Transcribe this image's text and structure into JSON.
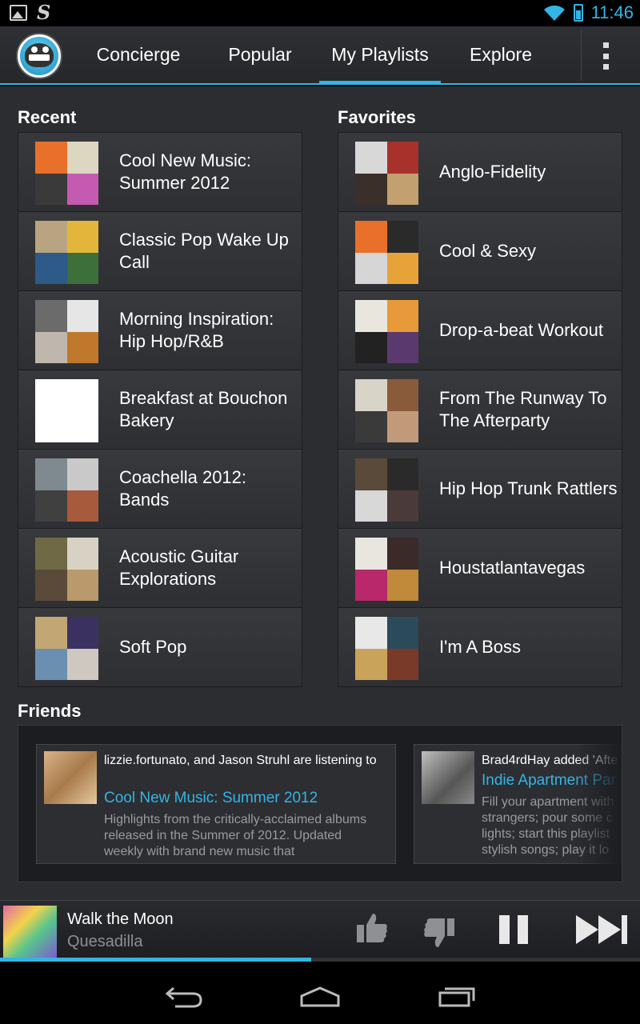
{
  "status_bar": {
    "time": "11:46"
  },
  "tabs": [
    "Concierge",
    "Popular",
    "My Playlists",
    "Explore"
  ],
  "active_tab": "My Playlists",
  "sections": {
    "recent": "Recent",
    "favorites": "Favorites",
    "friends": "Friends"
  },
  "recent": [
    {
      "title": "Cool New Music: Summer 2012",
      "colors": [
        "#e8702a",
        "#ddd6c0",
        "#3a3a3a",
        "#c45bb0"
      ]
    },
    {
      "title": "Classic Pop Wake Up Call",
      "colors": [
        "#b8a480",
        "#e3b63b",
        "#2d5a88",
        "#3d6f3a"
      ]
    },
    {
      "title": "Morning Inspiration: Hip Hop/R&B",
      "colors": [
        "#6b6b6b",
        "#e6e6e6",
        "#bfb7ad",
        "#c0782d"
      ]
    },
    {
      "title": "Breakfast at Bouchon Bakery",
      "colors": [
        "#ffffff",
        "#ffffff",
        "#ffffff",
        "#ffffff"
      ]
    },
    {
      "title": "Coachella 2012: Bands",
      "colors": [
        "#7e8a8f",
        "#c9c9c9",
        "#404040",
        "#a85a3c"
      ]
    },
    {
      "title": "Acoustic Guitar Explorations",
      "colors": [
        "#6f6a45",
        "#d8d2c4",
        "#5b4a3a",
        "#b89a6c"
      ]
    },
    {
      "title": "Soft Pop",
      "colors": [
        "#c2a774",
        "#3b3160",
        "#6b8fb0",
        "#cfc8c0"
      ]
    }
  ],
  "favorites": [
    {
      "title": "Anglo-Fidelity",
      "colors": [
        "#d8d8d8",
        "#a8322b",
        "#3b2f2a",
        "#c2a070"
      ]
    },
    {
      "title": "Cool & Sexy",
      "colors": [
        "#e8702a",
        "#2a2a2a",
        "#d6d6d6",
        "#e8a23a"
      ]
    },
    {
      "title": "Drop-a-beat Workout",
      "colors": [
        "#e9e6dd",
        "#e89a3a",
        "#222222",
        "#5a3a6e"
      ]
    },
    {
      "title": "From The Runway To The Afterparty",
      "colors": [
        "#d9d4c8",
        "#8a5b3a",
        "#3a3a3a",
        "#c29a7a"
      ]
    },
    {
      "title": "Hip Hop Trunk Rattlers",
      "colors": [
        "#5a4a3a",
        "#2a2a2a",
        "#d8d8d8",
        "#4a3a3a"
      ]
    },
    {
      "title": "Houstatlantavegas",
      "colors": [
        "#e9e6e0",
        "#3a2a28",
        "#b8286a",
        "#c08a3a"
      ]
    },
    {
      "title": "I'm A Boss",
      "colors": [
        "#e8e8e8",
        "#2b4a5a",
        "#c9a35a",
        "#7a3a2a"
      ]
    }
  ],
  "friends": [
    {
      "header": "lizzie.fortunato, and Jason Struhl are listening to",
      "playlist": "Cool New Music: Summer 2012",
      "description": "Highlights from the critically-acclaimed albums released in the Summer of 2012. Updated weekly with brand new music that"
    },
    {
      "header": "Brad4rdHay added 'Afte",
      "playlist": "Indie Apartment Par",
      "description": "Fill your apartment with strangers; pour some c lights; start this playlist stylish songs; play it lo"
    }
  ],
  "now_playing": {
    "title": "Walk the Moon",
    "artist": "Quesadilla",
    "progress": 0.486
  },
  "colors": {
    "accent": "#33b5e5",
    "background": "#2b2d31"
  }
}
